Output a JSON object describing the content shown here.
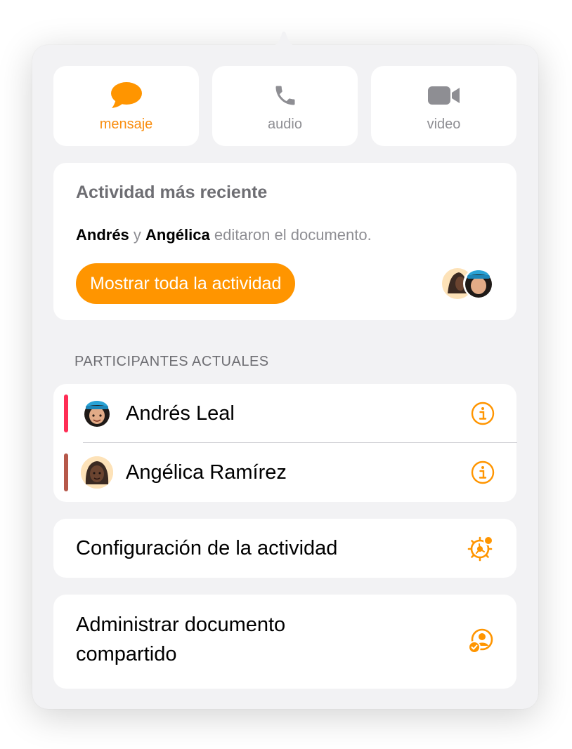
{
  "contact_buttons": [
    {
      "label": "mensaje",
      "icon": "message-bubble-icon",
      "active": true
    },
    {
      "label": "audio",
      "icon": "phone-icon",
      "active": false
    },
    {
      "label": "video",
      "icon": "video-camera-icon",
      "active": false
    }
  ],
  "activity": {
    "title": "Actividad más reciente",
    "name1": "Andrés",
    "connector": "y",
    "name2": "Angélica",
    "suffix": "editaron el documento.",
    "button_label": "Mostrar toda la actividad"
  },
  "participants": {
    "header": "PARTICIPANTES ACTUALES",
    "items": [
      {
        "name": "Andrés Leal",
        "color": "#ff2d55"
      },
      {
        "name": "Angélica Ramírez",
        "color": "#b6584a"
      }
    ]
  },
  "settings": {
    "activity_settings_label": "Configuración de la actividad",
    "manage_line1": "Administrar documento",
    "manage_line2": "compartido"
  },
  "colors": {
    "accent": "#ff9500",
    "inactive": "#8e8e93",
    "background": "#f2f2f4"
  }
}
